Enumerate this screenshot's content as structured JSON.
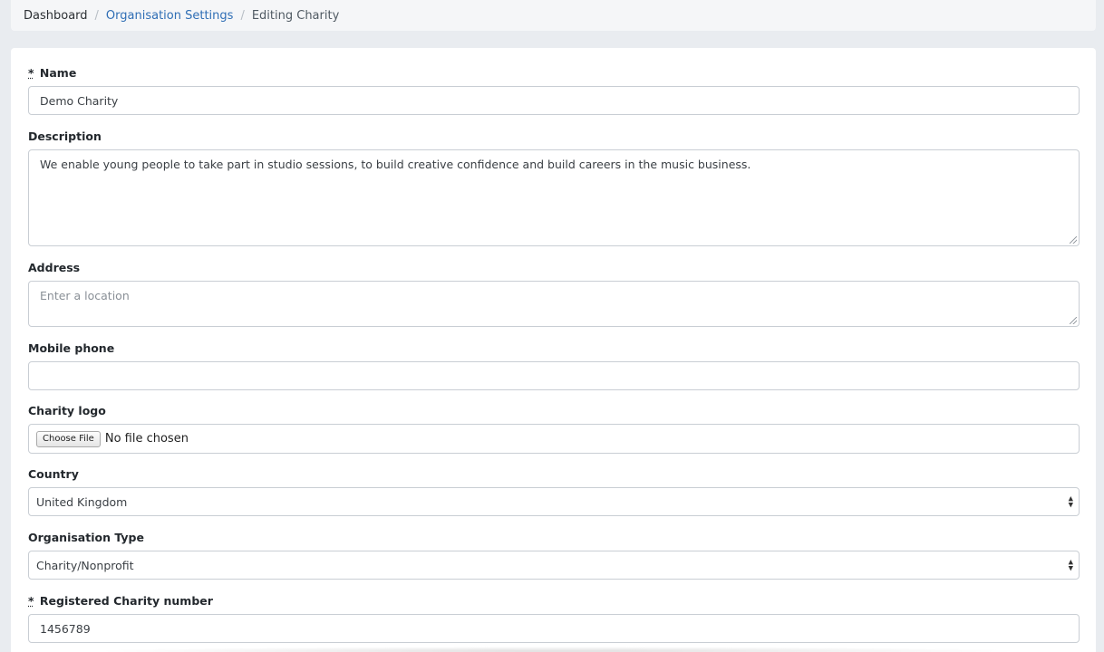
{
  "breadcrumb": {
    "items": [
      {
        "label": "Dashboard"
      },
      {
        "label": "Organisation Settings"
      },
      {
        "label": "Editing Charity"
      }
    ],
    "separator": "/"
  },
  "form": {
    "required_mark": "*",
    "name": {
      "label": "Name",
      "value": "Demo Charity"
    },
    "description": {
      "label": "Description",
      "value": "We enable young people to take part in studio sessions, to build creative confidence and build careers in the music business."
    },
    "address": {
      "label": "Address",
      "placeholder": "Enter a location",
      "value": ""
    },
    "mobile_phone": {
      "label": "Mobile phone",
      "value": ""
    },
    "charity_logo": {
      "label": "Charity logo",
      "button_label": "Choose File",
      "status": "No file chosen"
    },
    "country": {
      "label": "Country",
      "selected": "United Kingdom"
    },
    "organisation_type": {
      "label": "Organisation Type",
      "selected": "Charity/Nonprofit"
    },
    "registered_charity_number": {
      "label": "Registered Charity number",
      "value": "1456789"
    }
  },
  "icons": {
    "select_arrow_up": "▲",
    "select_arrow_down": "▼"
  }
}
